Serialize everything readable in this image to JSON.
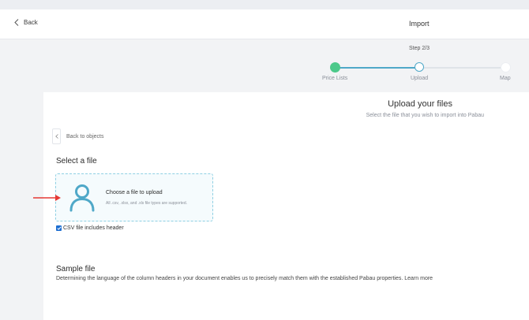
{
  "header": {
    "back_label": "Back",
    "title": "Import"
  },
  "stepper": {
    "step_text": "Step 2/3",
    "steps": [
      {
        "label": "Price Lists",
        "state": "done"
      },
      {
        "label": "Upload",
        "state": "current"
      },
      {
        "label": "Map",
        "state": "todo"
      }
    ]
  },
  "upload": {
    "title": "Upload your files",
    "subtitle": "Select the file that you wish to import into Pabau",
    "back_objects_label": "Back to objects",
    "select_heading": "Select a file",
    "dropzone_title": "Choose a file to upload",
    "dropzone_subtitle": "All .csv, .xlsx, and .xls file types are supported.",
    "csv_header_label": "CSV file includes header",
    "csv_header_checked": true
  },
  "sample": {
    "heading": "Sample file",
    "description": "Determining the language of the column headers in your document enables us to precisely match them with the established Pabau properties.",
    "learn_more": "Learn more"
  },
  "colors": {
    "done": "#4cc98a",
    "accent": "#4fa8c8",
    "arrow": "#e53935",
    "checkbox": "#1f6fd1"
  }
}
